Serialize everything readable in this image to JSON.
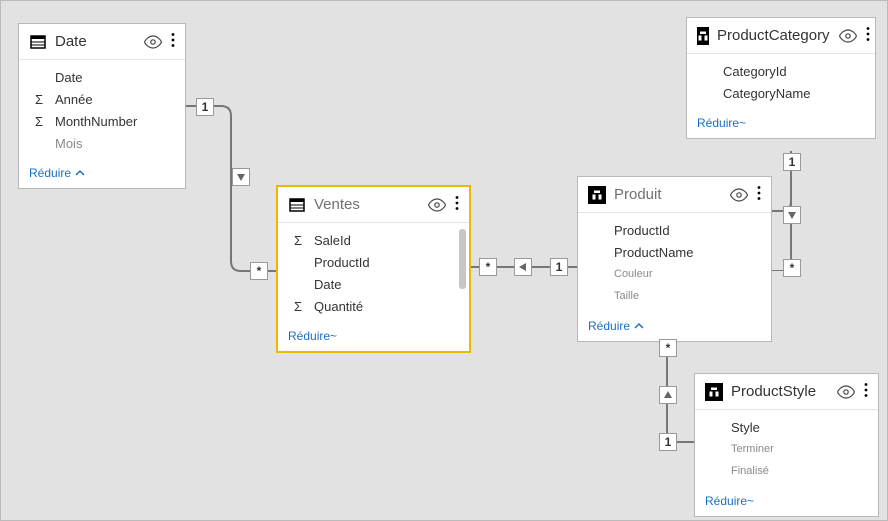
{
  "ui": {
    "collapse": "Réduire",
    "collapse_tilde": "Réduire~"
  },
  "tables": {
    "date": {
      "title": "Date",
      "fields": [
        {
          "name": "Date",
          "kind": "plain"
        },
        {
          "name": "Année",
          "kind": "sigma"
        },
        {
          "name": "MonthNumber",
          "kind": "sigma"
        },
        {
          "name": "Mois",
          "kind": "muted"
        }
      ]
    },
    "ventes": {
      "title": "Ventes",
      "fields": [
        {
          "name": "SaleId",
          "kind": "sigma"
        },
        {
          "name": "ProductId",
          "kind": "plain"
        },
        {
          "name": "Date",
          "kind": "plain"
        },
        {
          "name": "Quantité",
          "kind": "sigma"
        }
      ]
    },
    "produit": {
      "title": "Produit",
      "fields": [
        {
          "name": "ProductId",
          "kind": "plain"
        },
        {
          "name": "ProductName",
          "kind": "plain"
        },
        {
          "name": "Couleur",
          "kind": "small"
        },
        {
          "name": "Taille",
          "kind": "small"
        }
      ]
    },
    "productCategory": {
      "title": "ProductCategory",
      "fields": [
        {
          "name": "CategoryId",
          "kind": "plain"
        },
        {
          "name": "CategoryName",
          "kind": "plain"
        }
      ]
    },
    "productStyle": {
      "title": "ProductStyle",
      "fields": [
        {
          "name": "Style",
          "kind": "plain"
        },
        {
          "name": "Terminer",
          "kind": "small"
        },
        {
          "name": "Finalisé",
          "kind": "small"
        }
      ]
    }
  },
  "cardinality": {
    "one": "1",
    "many": "*"
  },
  "chart_data": {
    "type": "diagram",
    "title": "Power BI model view — tables and relationships",
    "tables": [
      {
        "name": "Date",
        "fields": [
          "Date",
          "Année",
          "MonthNumber",
          "Mois"
        ]
      },
      {
        "name": "Ventes",
        "fields": [
          "SaleId",
          "ProductId",
          "Date",
          "Quantité"
        ]
      },
      {
        "name": "Produit",
        "fields": [
          "ProductId",
          "ProductName",
          "Couleur",
          "Taille"
        ]
      },
      {
        "name": "ProductCategory",
        "fields": [
          "CategoryId",
          "CategoryName"
        ]
      },
      {
        "name": "ProductStyle",
        "fields": [
          "Style",
          "Terminer",
          "Finalisé"
        ]
      }
    ],
    "relationships": [
      {
        "from": "Date",
        "from_card": "1",
        "to": "Ventes",
        "to_card": "*",
        "direction": "single"
      },
      {
        "from": "Produit",
        "from_card": "1",
        "to": "Ventes",
        "to_card": "*",
        "direction": "single"
      },
      {
        "from": "ProductCategory",
        "from_card": "1",
        "to": "Produit",
        "to_card": "*",
        "direction": "single"
      },
      {
        "from": "ProductStyle",
        "from_card": "1",
        "to": "Produit",
        "to_card": "*",
        "direction": "single"
      }
    ]
  }
}
